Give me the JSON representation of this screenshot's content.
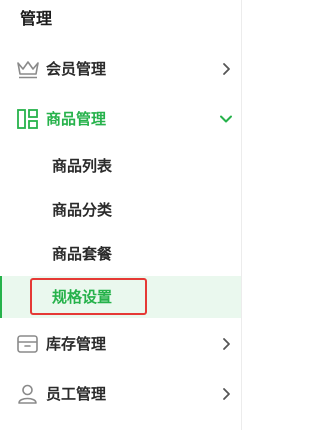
{
  "sidebar": {
    "section_title": "管理",
    "menu": [
      {
        "label": "会员管理",
        "icon": "crown-icon",
        "expanded": false
      },
      {
        "label": "商品管理",
        "icon": "product-grid-icon",
        "expanded": true,
        "children": [
          {
            "label": "商品列表"
          },
          {
            "label": "商品分类"
          },
          {
            "label": "商品套餐"
          },
          {
            "label": "规格设置",
            "selected": true
          }
        ]
      },
      {
        "label": "库存管理",
        "icon": "inventory-box-icon",
        "expanded": false
      },
      {
        "label": "员工管理",
        "icon": "user-icon",
        "expanded": false
      }
    ]
  },
  "colors": {
    "accent": "#26b24b",
    "selected_bg": "#eaf8ee",
    "text": "#2a2a2a",
    "icon_gray": "#8a8a8a",
    "highlight": "#e53935"
  }
}
